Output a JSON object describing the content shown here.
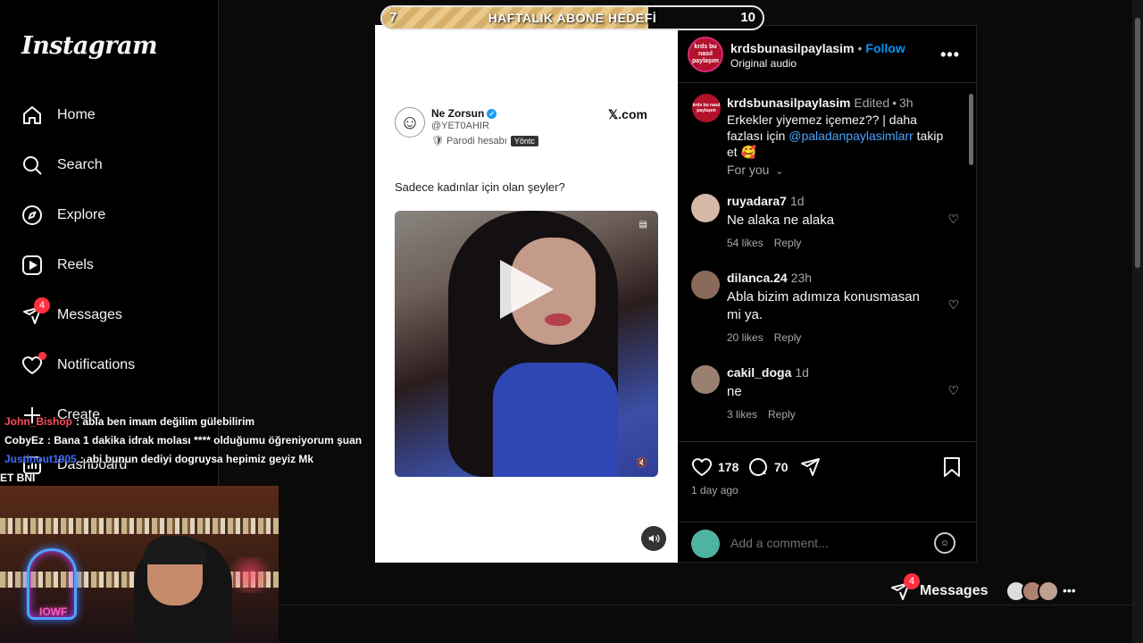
{
  "sidebar": {
    "logo": "Instagram",
    "items": [
      {
        "label": "Home",
        "icon": "home-icon"
      },
      {
        "label": "Search",
        "icon": "search-icon"
      },
      {
        "label": "Explore",
        "icon": "compass-icon"
      },
      {
        "label": "Reels",
        "icon": "reels-icon"
      },
      {
        "label": "Messages",
        "icon": "messenger-icon",
        "badge": "4"
      },
      {
        "label": "Notifications",
        "icon": "heart-icon"
      },
      {
        "label": "Create",
        "icon": "plus-icon"
      },
      {
        "label": "Dashboard",
        "icon": "dashboard-icon"
      }
    ]
  },
  "stream": {
    "goal": {
      "start": "7",
      "title": "HAFTALIK ABONE HEDEFİ",
      "end": "10",
      "progress": 0.7
    },
    "chat": [
      {
        "user": "John_Bishop",
        "color": "#ff4b5c",
        "text": "abla ben imam değilim gülebilirim"
      },
      {
        "user": "CobyEz",
        "color": "#f5f5f5",
        "text": "Bana 1 dakika idrak molası **** olduğumu öğreniyorum şuan"
      },
      {
        "user": "Justinout1905",
        "color": "#3b6bff",
        "text": "abi bunun dediyi dogruysa hepimiz geyiz Mk"
      },
      {
        "user": "",
        "color": "#f5f5f5",
        "text": "ET BNI"
      }
    ],
    "webcam_text": "IOWF"
  },
  "post": {
    "tweet": {
      "name": "Ne Zorsun",
      "handle": "@YET0AHIR",
      "parody": "Parodi hesabı",
      "parody_tag": "Yöntc",
      "site": "𝕏.com",
      "text": "Sadece kadınlar için olan şeyler?"
    },
    "header": {
      "username": "krdsbunasilpaylasim",
      "sep": "•",
      "follow": "Follow",
      "audio": "Original audio",
      "avatar_text": "krds bu nasıl paylaşım"
    },
    "caption": {
      "username": "krdsbunasilpaylasim",
      "edited": "Edited",
      "sep": "•",
      "time": "3h",
      "text_a": "Erkekler yiyemez içemez?? | daha fazlası için",
      "mention": "@paladanpaylasimlarr",
      "text_b": "takip et 🥰"
    },
    "for_you": "For you",
    "comments": [
      {
        "user": "ruyadara7",
        "time": "1d",
        "text": "Ne alaka ne alaka",
        "likes": "54 likes",
        "reply": "Reply",
        "avatar_color": "#d4b8a8"
      },
      {
        "user": "dilanca.24",
        "time": "23h",
        "text": "Abla bizim adımıza konusmasan mi ya.",
        "likes": "20 likes",
        "reply": "Reply",
        "avatar_color": "#8a6a5a"
      },
      {
        "user": "cakil_doga",
        "time": "1d",
        "text": "ne",
        "likes": "3 likes",
        "reply": "Reply",
        "avatar_color": "#9a8070"
      }
    ],
    "actions": {
      "likes": "178",
      "comments": "70",
      "time_ago": "1 day ago"
    },
    "add_comment_placeholder": "Add a comment..."
  },
  "messages_pill": {
    "label": "Messages",
    "badge": "4"
  }
}
